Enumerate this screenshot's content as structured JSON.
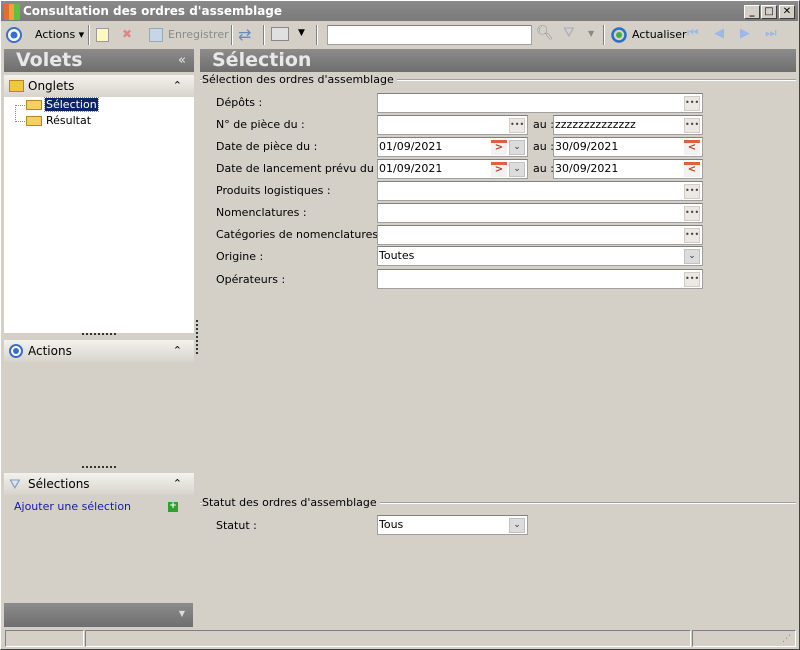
{
  "window": {
    "title": "Consultation des ordres d'assemblage"
  },
  "toolbar": {
    "actions": "Actions",
    "save": "Enregistrer",
    "search_value": "",
    "refresh": "Actualiser"
  },
  "left": {
    "title": "Volets",
    "onglets": "Onglets",
    "tree": [
      "Sélection",
      "Résultat"
    ],
    "actions": "Actions",
    "selections": "Sélections",
    "add_selection": "Ajouter une sélection"
  },
  "main": {
    "title": "Sélection",
    "group1": "Sélection des ordres d'assemblage",
    "group2": "Statut des ordres d'assemblage",
    "au": "au :",
    "fields": {
      "depots": "Dépôts :",
      "num_piece": "N° de pièce du :",
      "num_piece_to": "zzzzzzzzzzzzzz",
      "date_piece": "Date de pièce du :",
      "date_piece_from": "01/09/2021",
      "date_piece_to": "30/09/2021",
      "date_lancement": "Date de lancement prévu du :",
      "date_lancement_from": "01/09/2021",
      "date_lancement_to": "30/09/2021",
      "produits": "Produits logistiques :",
      "nomenclatures": "Nomenclatures :",
      "categories": "Catégories de nomenclatures :",
      "origine": "Origine :",
      "origine_value": "Toutes",
      "operateurs": "Opérateurs :",
      "statut": "Statut :",
      "statut_value": "Tous"
    }
  }
}
